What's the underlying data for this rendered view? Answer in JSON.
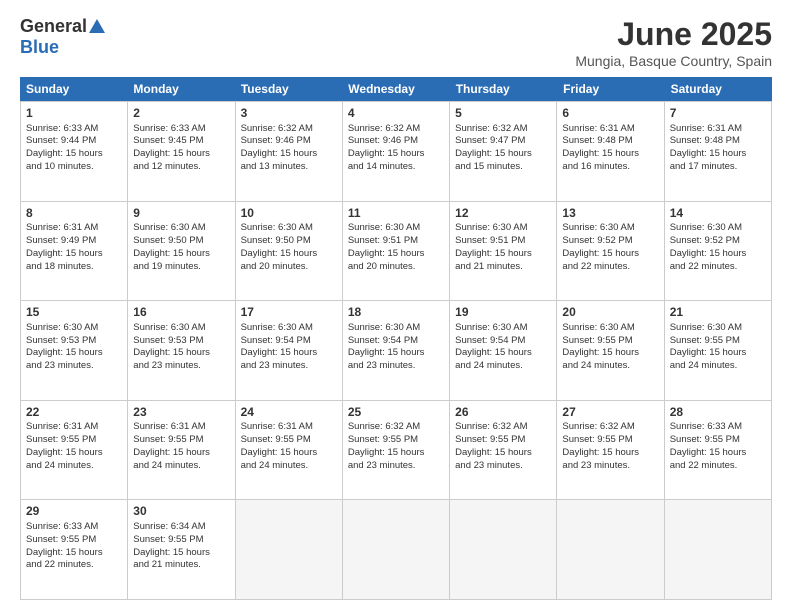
{
  "logo": {
    "general": "General",
    "blue": "Blue"
  },
  "title": "June 2025",
  "subtitle": "Mungia, Basque Country, Spain",
  "header_days": [
    "Sunday",
    "Monday",
    "Tuesday",
    "Wednesday",
    "Thursday",
    "Friday",
    "Saturday"
  ],
  "weeks": [
    [
      {
        "day": "1",
        "info": "Sunrise: 6:33 AM\nSunset: 9:44 PM\nDaylight: 15 hours\nand 10 minutes."
      },
      {
        "day": "2",
        "info": "Sunrise: 6:33 AM\nSunset: 9:45 PM\nDaylight: 15 hours\nand 12 minutes."
      },
      {
        "day": "3",
        "info": "Sunrise: 6:32 AM\nSunset: 9:46 PM\nDaylight: 15 hours\nand 13 minutes."
      },
      {
        "day": "4",
        "info": "Sunrise: 6:32 AM\nSunset: 9:46 PM\nDaylight: 15 hours\nand 14 minutes."
      },
      {
        "day": "5",
        "info": "Sunrise: 6:32 AM\nSunset: 9:47 PM\nDaylight: 15 hours\nand 15 minutes."
      },
      {
        "day": "6",
        "info": "Sunrise: 6:31 AM\nSunset: 9:48 PM\nDaylight: 15 hours\nand 16 minutes."
      },
      {
        "day": "7",
        "info": "Sunrise: 6:31 AM\nSunset: 9:48 PM\nDaylight: 15 hours\nand 17 minutes."
      }
    ],
    [
      {
        "day": "8",
        "info": "Sunrise: 6:31 AM\nSunset: 9:49 PM\nDaylight: 15 hours\nand 18 minutes."
      },
      {
        "day": "9",
        "info": "Sunrise: 6:30 AM\nSunset: 9:50 PM\nDaylight: 15 hours\nand 19 minutes."
      },
      {
        "day": "10",
        "info": "Sunrise: 6:30 AM\nSunset: 9:50 PM\nDaylight: 15 hours\nand 20 minutes."
      },
      {
        "day": "11",
        "info": "Sunrise: 6:30 AM\nSunset: 9:51 PM\nDaylight: 15 hours\nand 20 minutes."
      },
      {
        "day": "12",
        "info": "Sunrise: 6:30 AM\nSunset: 9:51 PM\nDaylight: 15 hours\nand 21 minutes."
      },
      {
        "day": "13",
        "info": "Sunrise: 6:30 AM\nSunset: 9:52 PM\nDaylight: 15 hours\nand 22 minutes."
      },
      {
        "day": "14",
        "info": "Sunrise: 6:30 AM\nSunset: 9:52 PM\nDaylight: 15 hours\nand 22 minutes."
      }
    ],
    [
      {
        "day": "15",
        "info": "Sunrise: 6:30 AM\nSunset: 9:53 PM\nDaylight: 15 hours\nand 23 minutes."
      },
      {
        "day": "16",
        "info": "Sunrise: 6:30 AM\nSunset: 9:53 PM\nDaylight: 15 hours\nand 23 minutes."
      },
      {
        "day": "17",
        "info": "Sunrise: 6:30 AM\nSunset: 9:54 PM\nDaylight: 15 hours\nand 23 minutes."
      },
      {
        "day": "18",
        "info": "Sunrise: 6:30 AM\nSunset: 9:54 PM\nDaylight: 15 hours\nand 23 minutes."
      },
      {
        "day": "19",
        "info": "Sunrise: 6:30 AM\nSunset: 9:54 PM\nDaylight: 15 hours\nand 24 minutes."
      },
      {
        "day": "20",
        "info": "Sunrise: 6:30 AM\nSunset: 9:55 PM\nDaylight: 15 hours\nand 24 minutes."
      },
      {
        "day": "21",
        "info": "Sunrise: 6:30 AM\nSunset: 9:55 PM\nDaylight: 15 hours\nand 24 minutes."
      }
    ],
    [
      {
        "day": "22",
        "info": "Sunrise: 6:31 AM\nSunset: 9:55 PM\nDaylight: 15 hours\nand 24 minutes."
      },
      {
        "day": "23",
        "info": "Sunrise: 6:31 AM\nSunset: 9:55 PM\nDaylight: 15 hours\nand 24 minutes."
      },
      {
        "day": "24",
        "info": "Sunrise: 6:31 AM\nSunset: 9:55 PM\nDaylight: 15 hours\nand 24 minutes."
      },
      {
        "day": "25",
        "info": "Sunrise: 6:32 AM\nSunset: 9:55 PM\nDaylight: 15 hours\nand 23 minutes."
      },
      {
        "day": "26",
        "info": "Sunrise: 6:32 AM\nSunset: 9:55 PM\nDaylight: 15 hours\nand 23 minutes."
      },
      {
        "day": "27",
        "info": "Sunrise: 6:32 AM\nSunset: 9:55 PM\nDaylight: 15 hours\nand 23 minutes."
      },
      {
        "day": "28",
        "info": "Sunrise: 6:33 AM\nSunset: 9:55 PM\nDaylight: 15 hours\nand 22 minutes."
      }
    ],
    [
      {
        "day": "29",
        "info": "Sunrise: 6:33 AM\nSunset: 9:55 PM\nDaylight: 15 hours\nand 22 minutes."
      },
      {
        "day": "30",
        "info": "Sunrise: 6:34 AM\nSunset: 9:55 PM\nDaylight: 15 hours\nand 21 minutes."
      },
      {
        "day": "",
        "info": ""
      },
      {
        "day": "",
        "info": ""
      },
      {
        "day": "",
        "info": ""
      },
      {
        "day": "",
        "info": ""
      },
      {
        "day": "",
        "info": ""
      }
    ]
  ]
}
